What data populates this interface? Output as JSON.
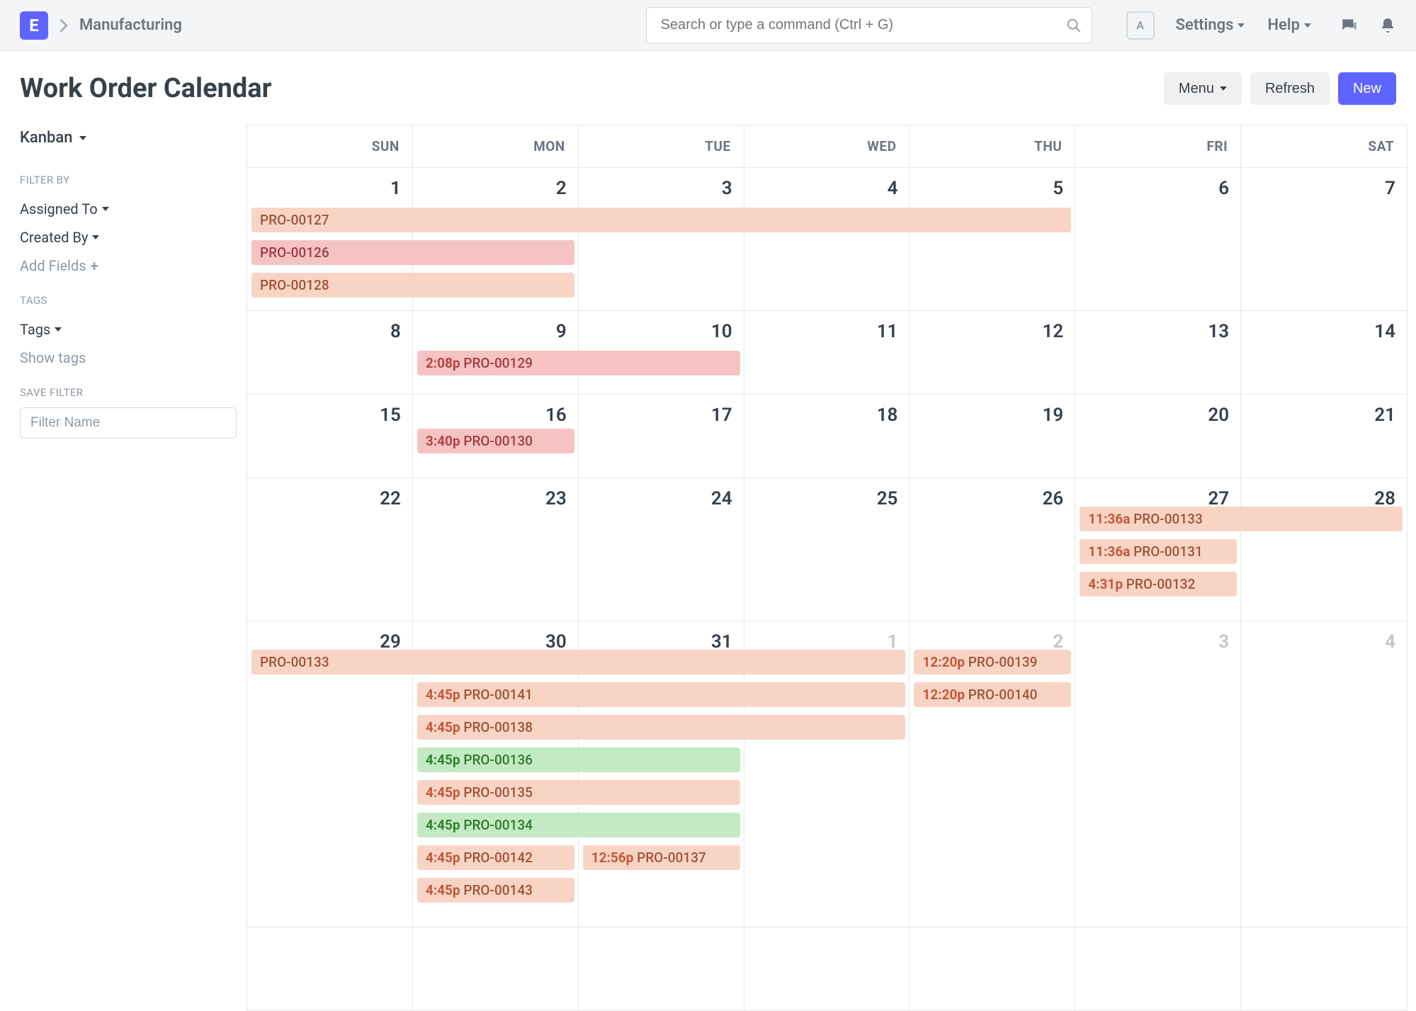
{
  "topbar": {
    "logo_letter": "E",
    "breadcrumb": "Manufacturing",
    "search_placeholder": "Search or type a command (Ctrl + G)",
    "user_initial": "A",
    "settings_label": "Settings",
    "help_label": "Help"
  },
  "header": {
    "title": "Work Order Calendar",
    "menu_label": "Menu",
    "refresh_label": "Refresh",
    "new_label": "New"
  },
  "sidebar": {
    "view_label": "Kanban",
    "filter_heading": "FILTER BY",
    "filters": [
      {
        "label": "Assigned To"
      },
      {
        "label": "Created By"
      }
    ],
    "add_fields_label": "Add Fields",
    "tags_heading": "TAGS",
    "tags_label": "Tags",
    "show_tags_label": "Show tags",
    "save_filter_heading": "SAVE FILTER",
    "filter_name_placeholder": "Filter Name"
  },
  "calendar": {
    "day_headers": [
      "SUN",
      "MON",
      "TUE",
      "WED",
      "THU",
      "FRI",
      "SAT"
    ],
    "weeks": [
      {
        "days": [
          {
            "n": "1"
          },
          {
            "n": "2"
          },
          {
            "n": "3"
          },
          {
            "n": "4"
          },
          {
            "n": "5"
          },
          {
            "n": "6"
          },
          {
            "n": "7"
          }
        ]
      },
      {
        "days": [
          {
            "n": "8"
          },
          {
            "n": "9"
          },
          {
            "n": "10"
          },
          {
            "n": "11"
          },
          {
            "n": "12"
          },
          {
            "n": "13"
          },
          {
            "n": "14"
          }
        ]
      },
      {
        "days": [
          {
            "n": "15"
          },
          {
            "n": "16"
          },
          {
            "n": "17"
          },
          {
            "n": "18"
          },
          {
            "n": "19"
          },
          {
            "n": "20"
          },
          {
            "n": "21"
          }
        ]
      },
      {
        "days": [
          {
            "n": "22"
          },
          {
            "n": "23"
          },
          {
            "n": "24"
          },
          {
            "n": "25"
          },
          {
            "n": "26"
          },
          {
            "n": "27"
          },
          {
            "n": "28"
          }
        ]
      },
      {
        "days": [
          {
            "n": "29"
          },
          {
            "n": "30"
          },
          {
            "n": "31"
          },
          {
            "n": "1",
            "fade": true
          },
          {
            "n": "2",
            "fade": true
          },
          {
            "n": "3",
            "fade": true
          },
          {
            "n": "4",
            "fade": true
          }
        ]
      },
      {
        "days": [
          {
            "n": ""
          },
          {
            "n": ""
          },
          {
            "n": ""
          },
          {
            "n": ""
          },
          {
            "n": ""
          },
          {
            "n": ""
          },
          {
            "n": ""
          }
        ],
        "short": true
      }
    ],
    "events": [
      {
        "row": 0,
        "lane": 0,
        "start": 0,
        "span": 5,
        "color": "peach",
        "time": "",
        "title": "PRO-00127"
      },
      {
        "row": 0,
        "lane": 1,
        "start": 0,
        "span": 2,
        "color": "pink",
        "time": "",
        "title": "PRO-00126"
      },
      {
        "row": 0,
        "lane": 2,
        "start": 0,
        "span": 2,
        "color": "peach",
        "time": "",
        "title": "PRO-00128"
      },
      {
        "row": 1,
        "lane": 0,
        "start": 1,
        "span": 2,
        "color": "pink",
        "time": "2:08p",
        "title": "PRO-00129"
      },
      {
        "row": 2,
        "lane": 0,
        "start": 1,
        "span": 1,
        "color": "pink",
        "time": "3:40p",
        "title": "PRO-00130"
      },
      {
        "row": 3,
        "lane": 0,
        "start": 5,
        "span": 2,
        "color": "peach",
        "time": "11:36a",
        "title": "PRO-00133"
      },
      {
        "row": 3,
        "lane": 1,
        "start": 5,
        "span": 1,
        "color": "peach",
        "time": "11:36a",
        "title": "PRO-00131"
      },
      {
        "row": 3,
        "lane": 2,
        "start": 5,
        "span": 1,
        "color": "peach",
        "time": "4:31p",
        "title": "PRO-00132"
      },
      {
        "row": 4,
        "lane": 0,
        "start": 0,
        "span": 4,
        "color": "peach",
        "time": "",
        "title": "PRO-00133"
      },
      {
        "row": 4,
        "lane": 0,
        "start": 4,
        "span": 1,
        "color": "peach",
        "time": "12:20p",
        "title": "PRO-00139"
      },
      {
        "row": 4,
        "lane": 1,
        "start": 1,
        "span": 3,
        "color": "peach",
        "time": "4:45p",
        "title": "PRO-00141"
      },
      {
        "row": 4,
        "lane": 1,
        "start": 4,
        "span": 1,
        "color": "peach",
        "time": "12:20p",
        "title": "PRO-00140"
      },
      {
        "row": 4,
        "lane": 2,
        "start": 1,
        "span": 3,
        "color": "peach",
        "time": "4:45p",
        "title": "PRO-00138"
      },
      {
        "row": 4,
        "lane": 3,
        "start": 1,
        "span": 2,
        "color": "green",
        "time": "4:45p",
        "title": "PRO-00136"
      },
      {
        "row": 4,
        "lane": 4,
        "start": 1,
        "span": 2,
        "color": "peach",
        "time": "4:45p",
        "title": "PRO-00135"
      },
      {
        "row": 4,
        "lane": 5,
        "start": 1,
        "span": 2,
        "color": "green",
        "time": "4:45p",
        "title": "PRO-00134"
      },
      {
        "row": 4,
        "lane": 6,
        "start": 1,
        "span": 1,
        "color": "peach",
        "time": "4:45p",
        "title": "PRO-00142"
      },
      {
        "row": 4,
        "lane": 6,
        "start": 2,
        "span": 1,
        "color": "peach",
        "time": "12:56p",
        "title": "PRO-00137"
      },
      {
        "row": 4,
        "lane": 7,
        "start": 1,
        "span": 1,
        "color": "peach",
        "time": "4:45p",
        "title": "PRO-00143"
      }
    ]
  }
}
